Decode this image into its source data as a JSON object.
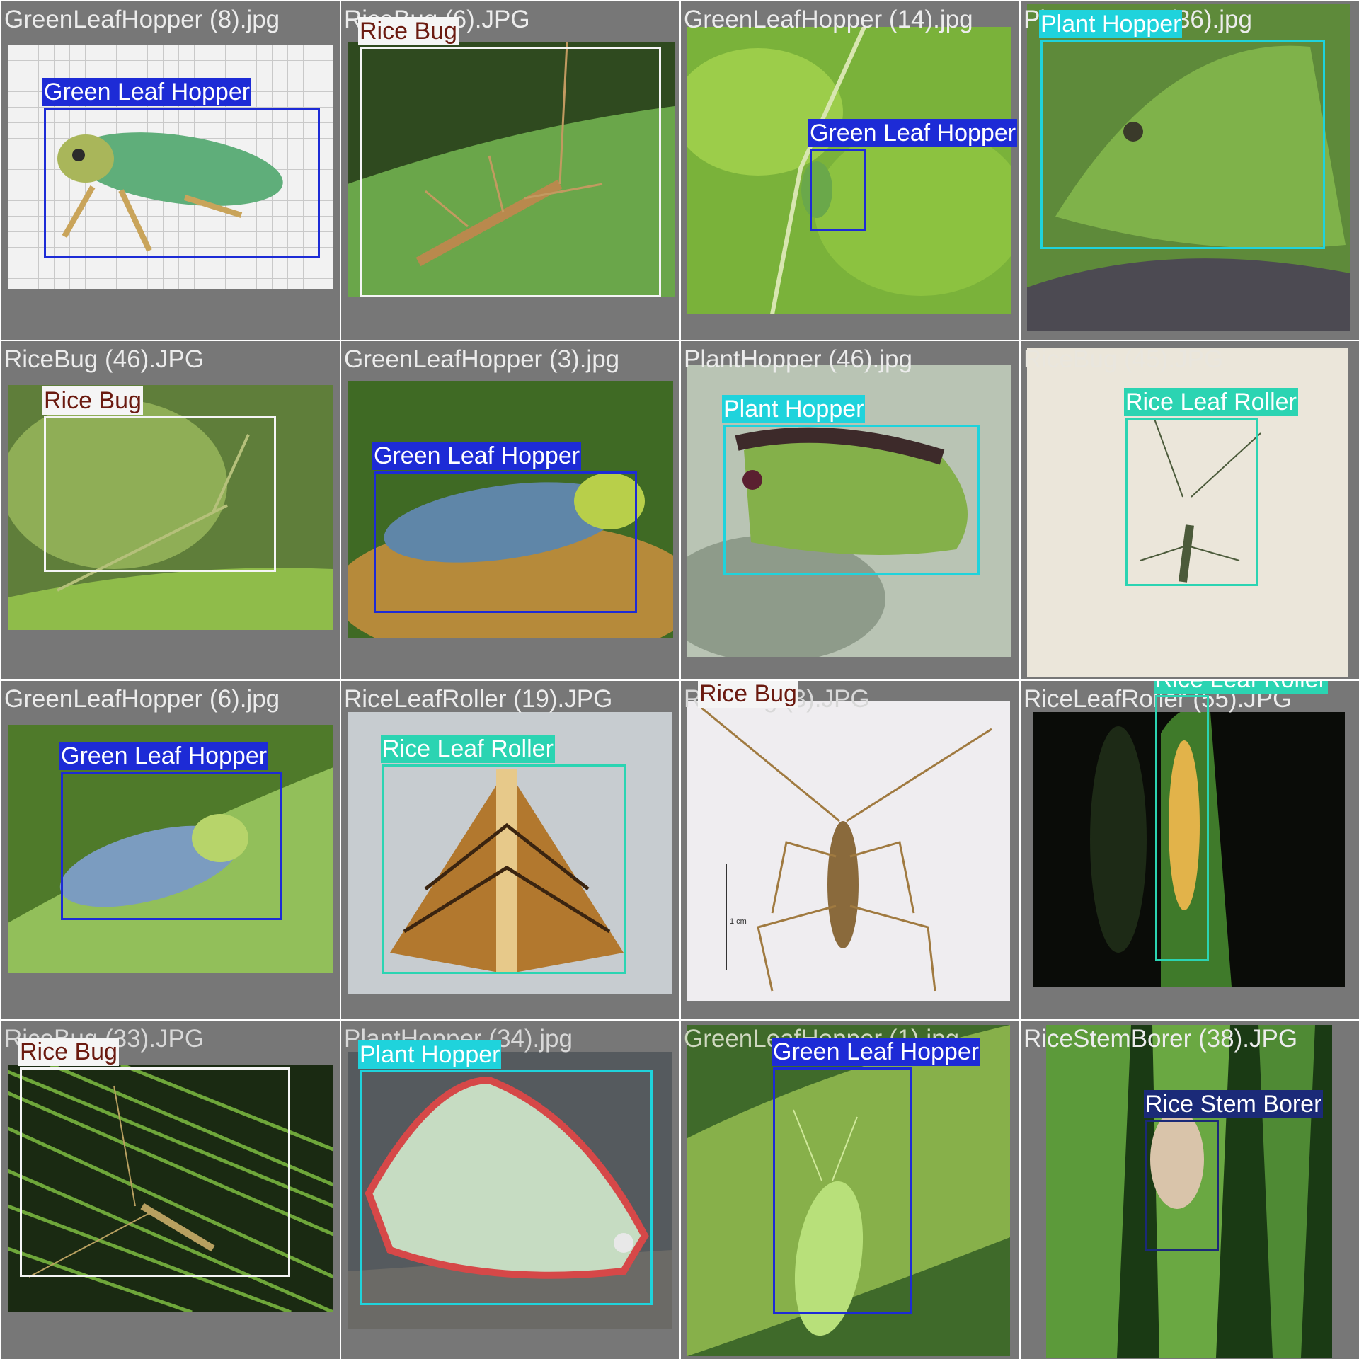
{
  "classes": {
    "green_leaf_hopper": {
      "label": "Green Leaf Hopper",
      "box_color": "#1d2bd6",
      "text_color": "#ffffff"
    },
    "rice_bug": {
      "label": "Rice Bug",
      "box_color": "#f5f5f5",
      "text_color": "#6b1a10"
    },
    "plant_hopper": {
      "label": "Plant Hopper",
      "box_color": "#1fd3dc",
      "text_color": "#ffffff"
    },
    "rice_leaf_roller": {
      "label": "Rice Leaf Roller",
      "box_color": "#2bd4b2",
      "text_color": "#ffffff"
    },
    "rice_stem_borer": {
      "label": "Rice Stem Borer",
      "box_color": "#1b2a78",
      "text_color": "#ffffff"
    }
  },
  "tiles": [
    {
      "filename": "GreenLeafHopper (8).jpg",
      "label": "Green Leaf Hopper"
    },
    {
      "filename": "RiceBug (6).JPG",
      "label": "Rice Bug"
    },
    {
      "filename": "GreenLeafHopper (14).jpg",
      "label": "Green Leaf Hopper"
    },
    {
      "filename": "PlantHopper (36).jpg",
      "label": "Plant Hopper"
    },
    {
      "filename": "RiceBug (46).JPG",
      "label": "Rice Bug"
    },
    {
      "filename": "GreenLeafHopper (3).jpg",
      "label": "Green Leaf Hopper"
    },
    {
      "filename": "PlantHopper (46).jpg",
      "label": "Plant Hopper"
    },
    {
      "filename": "RiceBug (45).JPG",
      "label": "Rice Leaf Roller"
    },
    {
      "filename": "GreenLeafHopper (6).jpg",
      "label": "Green Leaf Hopper"
    },
    {
      "filename": "RiceLeafRoller (19).JPG",
      "label": "Rice Leaf Roller"
    },
    {
      "filename": "RiceBug (3).JPG",
      "label": "Rice Bug"
    },
    {
      "filename": "RiceLeafRoller (55).JPG",
      "label": "Rice Leaf Roller"
    },
    {
      "filename": "RiceBug (33).JPG",
      "label": "Rice Bug"
    },
    {
      "filename": "PlantHopper (34).jpg",
      "label": "Plant Hopper"
    },
    {
      "filename": "GreenLeafHopper (1).jpg",
      "label": "Green Leaf Hopper"
    },
    {
      "filename": "RiceStemBorer (38).JPG",
      "label": "Rice Stem Borer"
    }
  ],
  "scale_bar_text": "1 cm"
}
